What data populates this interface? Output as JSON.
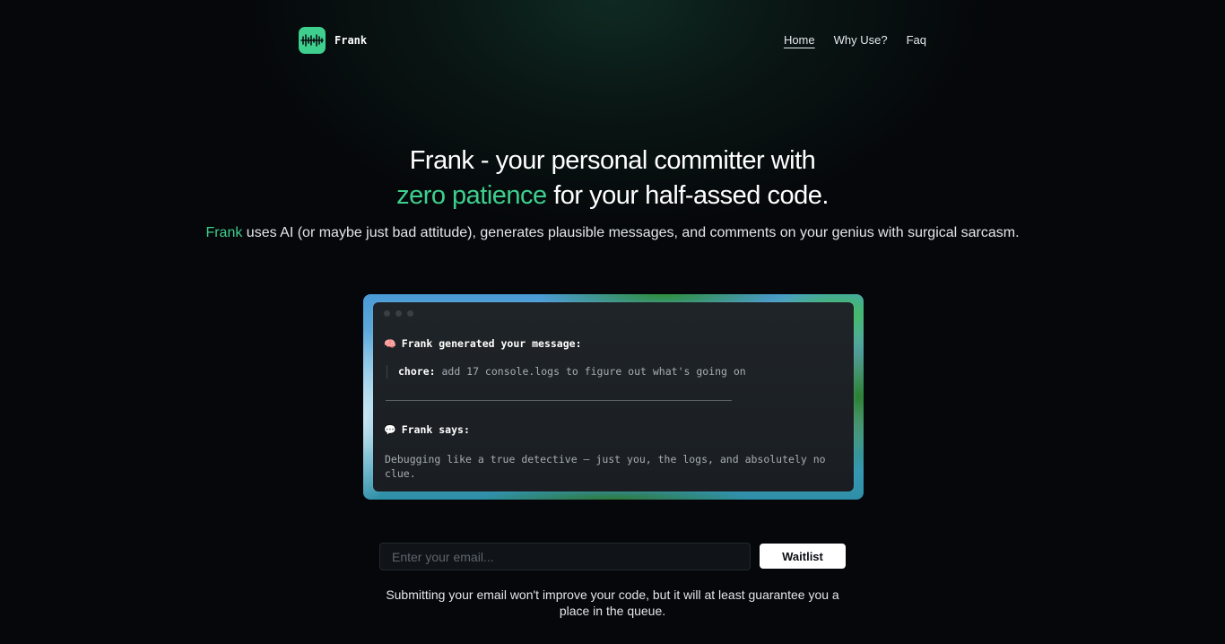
{
  "header": {
    "brand_name": "Frank",
    "nav": [
      {
        "label": "Home",
        "active": true
      },
      {
        "label": "Why Use?",
        "active": false
      },
      {
        "label": "Faq",
        "active": false
      }
    ]
  },
  "hero": {
    "title_line1": "Frank - your personal committer with",
    "title_accent": "zero patience",
    "title_line2_rest": " for your half-assed code.",
    "sub_accent": "Frank",
    "sub_rest": " uses AI (or maybe just bad attitude), generates plausible messages, and comments on your genius with surgical sarcasm."
  },
  "terminal": {
    "generated_icon": "brain-icon",
    "generated_label": "Frank generated your message:",
    "commit_type": "chore:",
    "commit_message": " add 17 console.logs to figure out what's going on",
    "says_icon": "speech-bubble-icon",
    "says_label": "Frank says:",
    "says_text": "Debugging like a true detective — just you, the logs, and absolutely no clue."
  },
  "form": {
    "email_placeholder": "Enter your email...",
    "email_value": "",
    "submit_label": "Waitlist",
    "footnote": "Submitting your email won't improve your code, but it will at least guarantee you a place in the queue."
  },
  "colors": {
    "accent": "#3ecf8e",
    "background": "#05070a",
    "terminal": "#1c2024"
  }
}
